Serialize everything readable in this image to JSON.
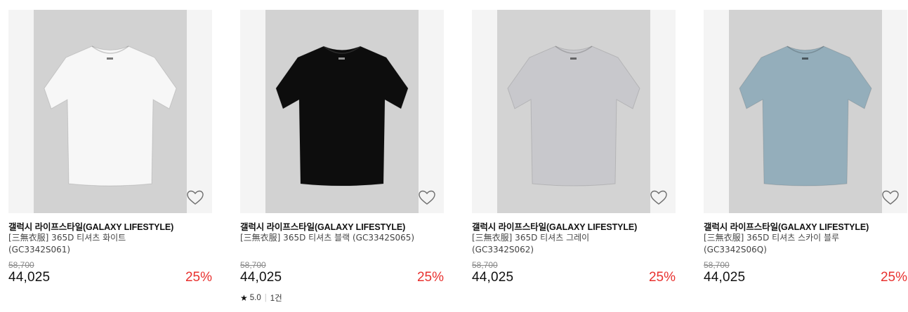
{
  "products": [
    {
      "brand": "갤럭시 라이프스타일(GALAXY LIFESTYLE)",
      "name": "[三無衣服] 365D 티셔츠 화이트 (GC3342S061)",
      "original_price": "58,700",
      "price": "44,025",
      "discount": "25%",
      "shirt_color": "#f7f7f7",
      "background_color": "#d2d2d2",
      "wishlist_icon": "heart-outline-icon"
    },
    {
      "brand": "갤럭시 라이프스타일(GALAXY LIFESTYLE)",
      "name": "[三無衣服] 365D 티셔츠 블랙 (GC3342S065)",
      "original_price": "58,700",
      "price": "44,025",
      "discount": "25%",
      "rating": "5.0",
      "review_count": "1건",
      "shirt_color": "#0d0d0d",
      "background_color": "#d2d2d2",
      "wishlist_icon": "heart-outline-icon"
    },
    {
      "brand": "갤럭시 라이프스타일(GALAXY LIFESTYLE)",
      "name": "[三無衣服] 365D 티셔츠 그레이 (GC3342S062)",
      "original_price": "58,700",
      "price": "44,025",
      "discount": "25%",
      "shirt_color": "#c8c8cc",
      "background_color": "#d3d3d3",
      "wishlist_icon": "heart-outline-icon"
    },
    {
      "brand": "갤럭시 라이프스타일(GALAXY LIFESTYLE)",
      "name": "[三無衣服] 365D 티셔츠 스카이 블루 (GC3342S06Q)",
      "original_price": "58,700",
      "price": "44,025",
      "discount": "25%",
      "shirt_color": "#94aebb",
      "background_color": "#d2d2d2",
      "wishlist_icon": "heart-outline-icon"
    }
  ],
  "colors": {
    "discount": "#e8312f",
    "original_price": "#888888",
    "thumbnail_bg": "#f4f4f4"
  }
}
